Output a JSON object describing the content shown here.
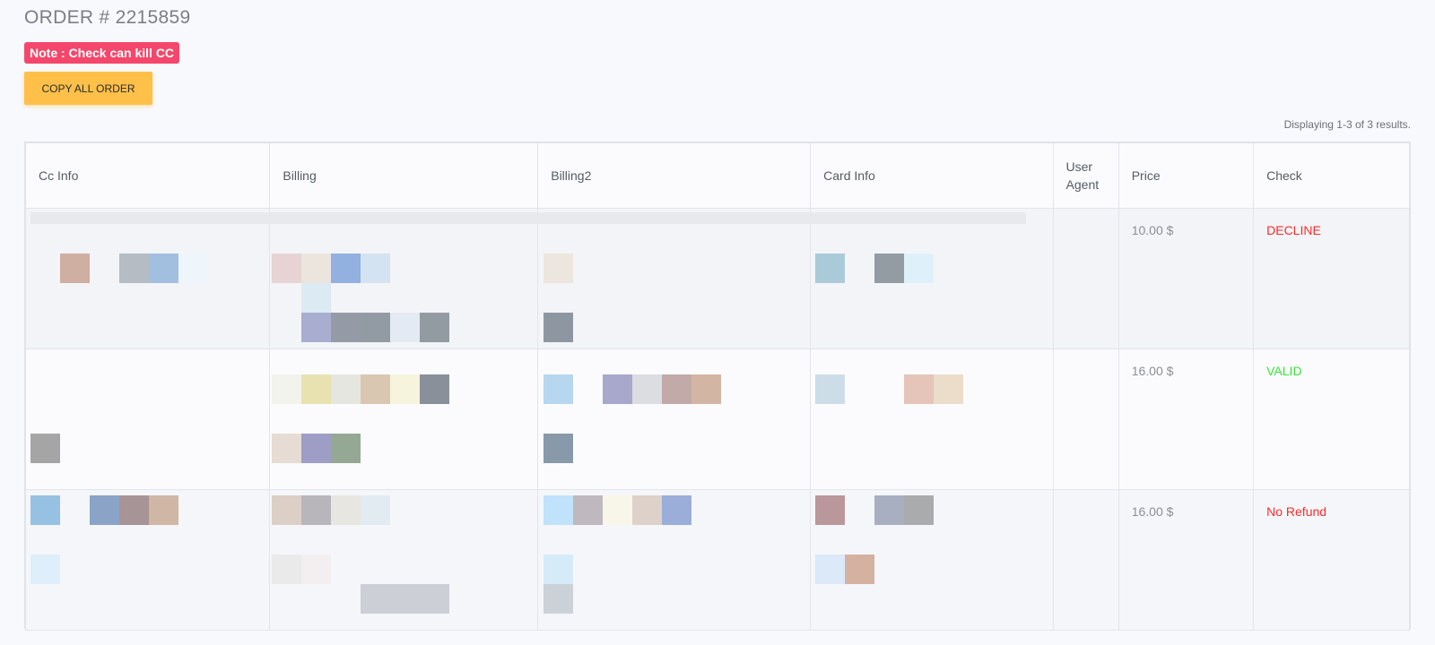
{
  "order": {
    "title": "ORDER # 2215859",
    "note": "Note : Check can kill CC",
    "copy_button": "COPY ALL ORDER",
    "summary": "Displaying 1-3 of 3 results."
  },
  "table": {
    "headers": {
      "cc_info": "Cc Info",
      "billing": "Billing",
      "billing2": "Billing2",
      "card_info": "Card Info",
      "user_agent": "User Agent",
      "price": "Price",
      "check": "Check"
    },
    "rows": [
      {
        "price": "10.00 $",
        "check": "DECLINE",
        "check_color": "#ff2a2a"
      },
      {
        "price": "16.00 $",
        "check": "VALID",
        "check_color": "#34e834"
      },
      {
        "price": "16.00 $",
        "check": "No Refund",
        "check_color": "#ff2a2a"
      }
    ]
  },
  "colors": {
    "note_badge": "#f4476b",
    "copy_button": "#fec048",
    "decline": "#ff2a2a",
    "valid": "#34e834"
  }
}
